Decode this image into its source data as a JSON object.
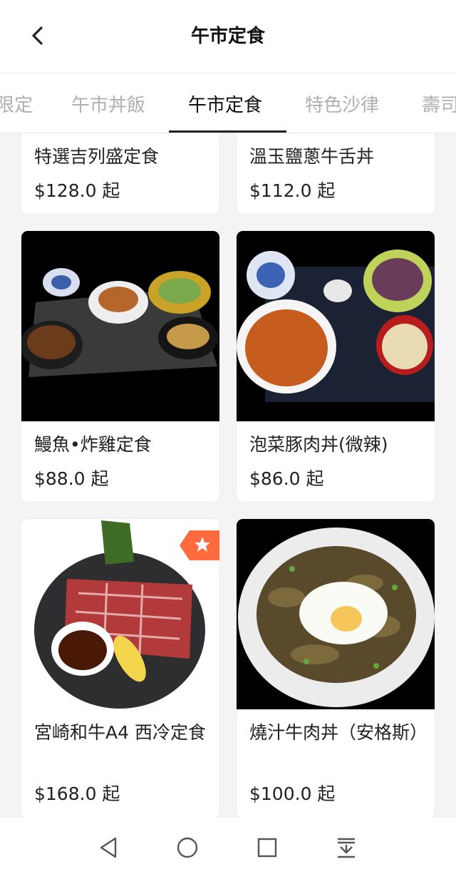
{
  "header": {
    "title": "午市定食"
  },
  "tabs": [
    {
      "label": "限定"
    },
    {
      "label": "午市丼飯"
    },
    {
      "label": "午市定食"
    },
    {
      "label": "特色沙律"
    },
    {
      "label": "壽司"
    }
  ],
  "products": [
    {
      "name": "特選吉列盛定食",
      "price": "$128.0 起"
    },
    {
      "name": "溫玉鹽蔥牛舌丼",
      "price": "$112.0 起"
    },
    {
      "name": "鰻魚•炸雞定食",
      "price": "$88.0 起"
    },
    {
      "name": "泡菜豚肉丼(微辣)",
      "price": "$86.0 起"
    },
    {
      "name": "宮崎和牛A4 西冷定食",
      "price": "$168.0 起"
    },
    {
      "name": "燒汁牛肉丼（安格斯）",
      "price": "$100.0 起"
    }
  ],
  "colors": {
    "badge": "#ff6b3d",
    "active_tab": "#111111",
    "inactive_tab": "#b0b0b0"
  },
  "icons": [
    "back-arrow-icon",
    "star-icon",
    "nav-back-icon",
    "nav-home-icon",
    "nav-recents-icon",
    "nav-menu-icon"
  ]
}
